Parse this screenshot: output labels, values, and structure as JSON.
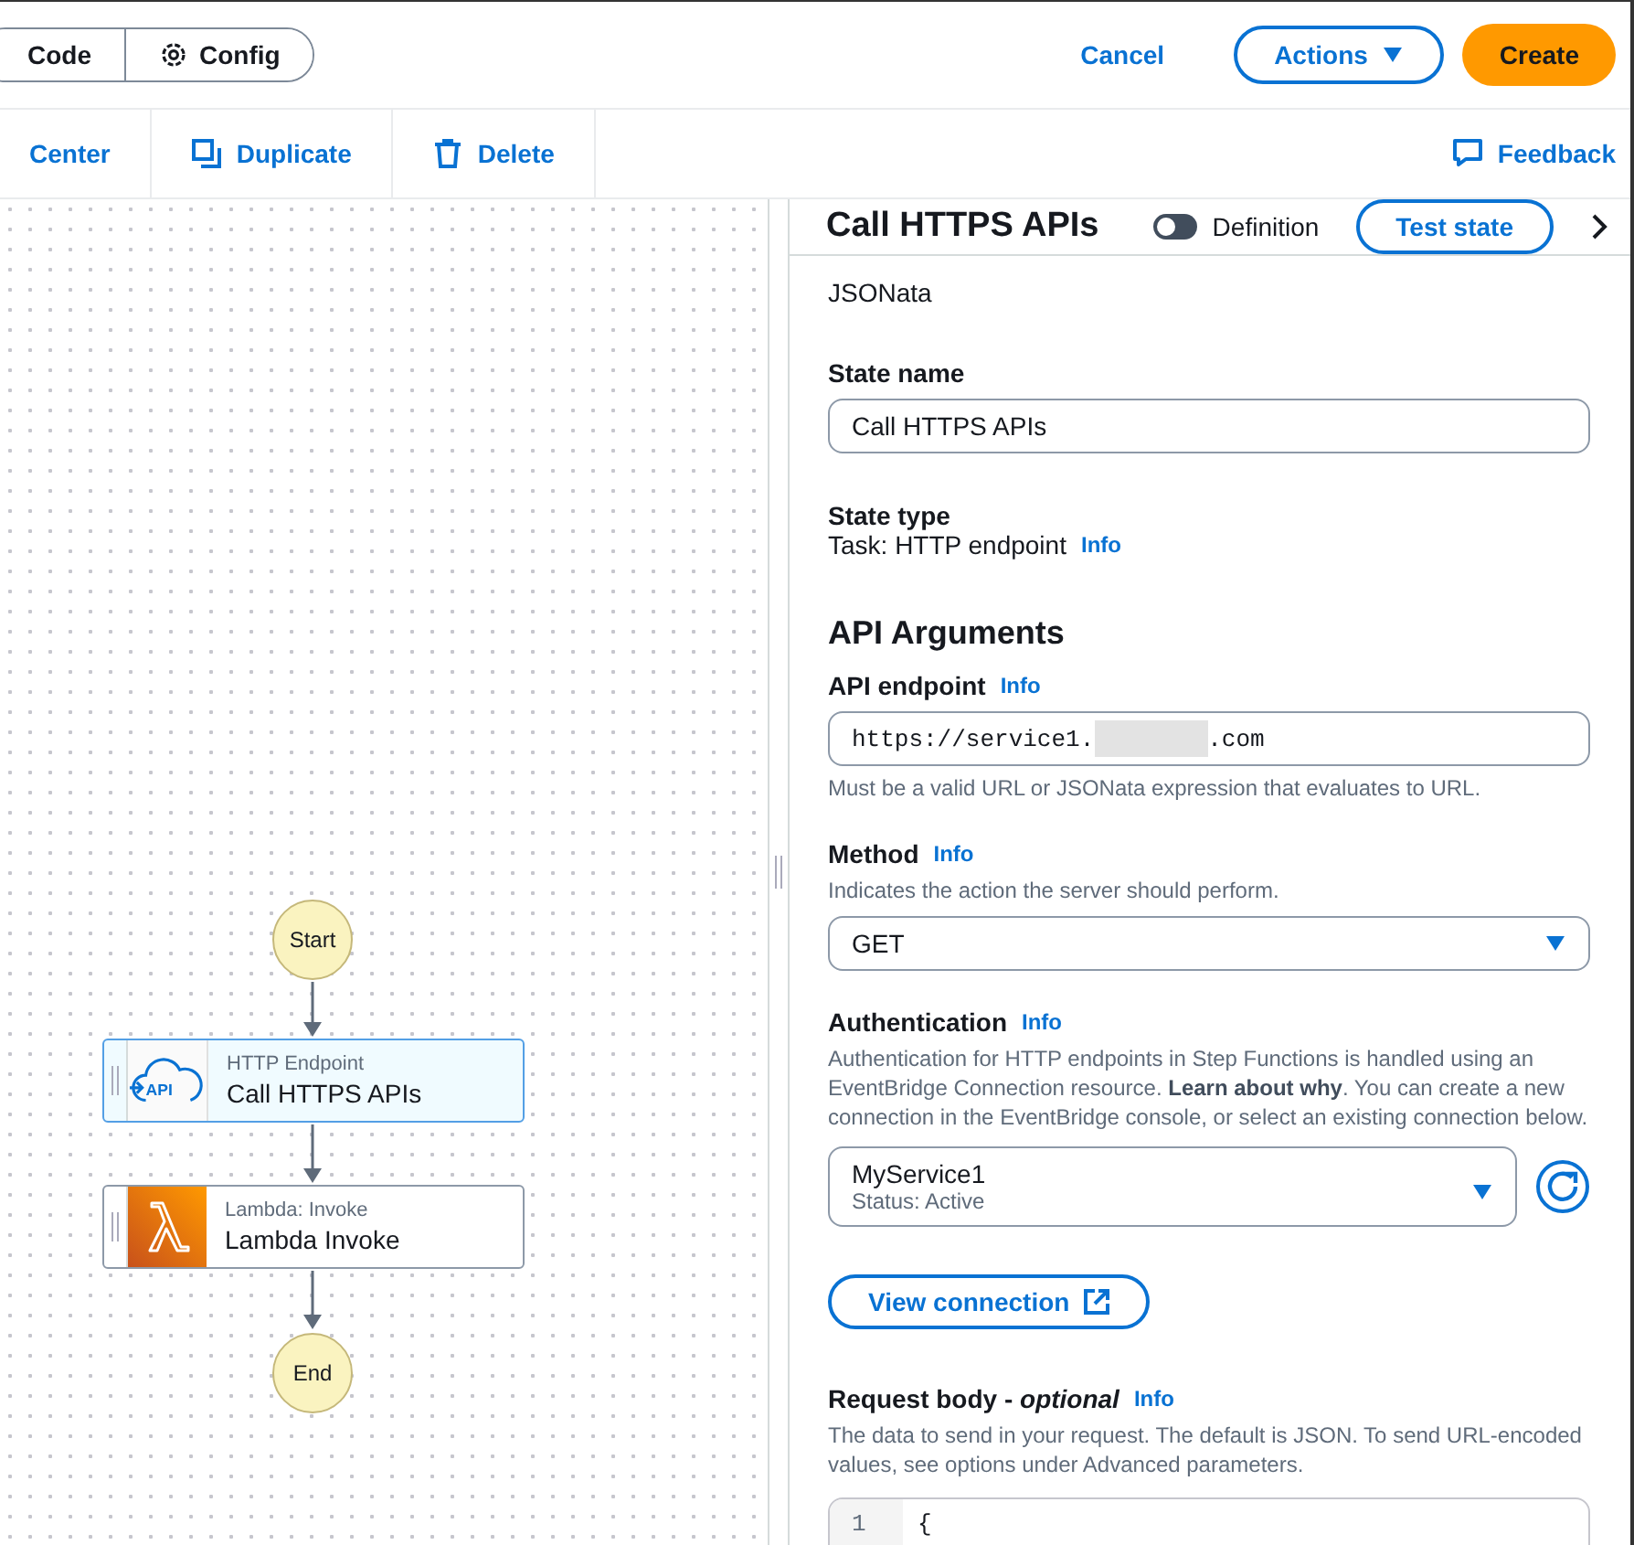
{
  "top_bar": {
    "view_tabs": [
      {
        "label": "Code",
        "selected": false
      },
      {
        "label": "Config",
        "selected": false
      }
    ],
    "cancel": "Cancel",
    "actions": "Actions",
    "create": "Create"
  },
  "toolbar": {
    "buttons": [
      {
        "kind": "center",
        "label": "Center"
      },
      {
        "kind": "duplicate",
        "label": "Duplicate"
      },
      {
        "kind": "delete",
        "label": "Delete"
      }
    ],
    "feedback": "Feedback"
  },
  "diagram": {
    "start": "Start",
    "end": "End",
    "states": [
      {
        "kind": "http",
        "icon_text": "API",
        "type": "HTTP Endpoint",
        "name": "Call HTTPS APIs",
        "selected": true
      },
      {
        "kind": "lambda",
        "type": "Lambda: Invoke",
        "name": "Lambda Invoke",
        "selected": false
      }
    ]
  },
  "panel": {
    "title": "Call HTTPS APIs",
    "definition_toggle": {
      "label": "Definition",
      "on": false
    },
    "test_button": "Test state",
    "query_language_value": "JSONata",
    "state_name": {
      "label": "State name",
      "value": "Call HTTPS APIs"
    },
    "state_type": {
      "label": "State type",
      "value": "Task: HTTP endpoint",
      "info": "Info"
    },
    "section_title": "API Arguments",
    "endpoint": {
      "label": "API endpoint",
      "info": "Info",
      "value_start": "https://service1.",
      "value_end": ".com",
      "redacted": true,
      "hint": "Must be a valid URL or JSONata expression that evaluates to URL."
    },
    "method": {
      "label": "Method",
      "info": "Info",
      "description": "Indicates the action the server should perform.",
      "value": "GET"
    },
    "authentication": {
      "label": "Authentication",
      "info": "Info",
      "description": "Authentication for HTTP endpoints in Step Functions is handled using an EventBridge Connection resource. **Learn about why**. You can create a new connection in the EventBridge console, or select an existing connection below.",
      "connection": "MyService1",
      "status": "Status: Active",
      "view_button": "View connection"
    },
    "request_body": {
      "label": "Request body - *optional*",
      "info": "Info",
      "description": "The data to send in your request. The default is JSON. To send URL-encoded values, see options under Advanced parameters.",
      "lines": [
        {
          "number": "1",
          "code": "{"
        }
      ]
    }
  }
}
